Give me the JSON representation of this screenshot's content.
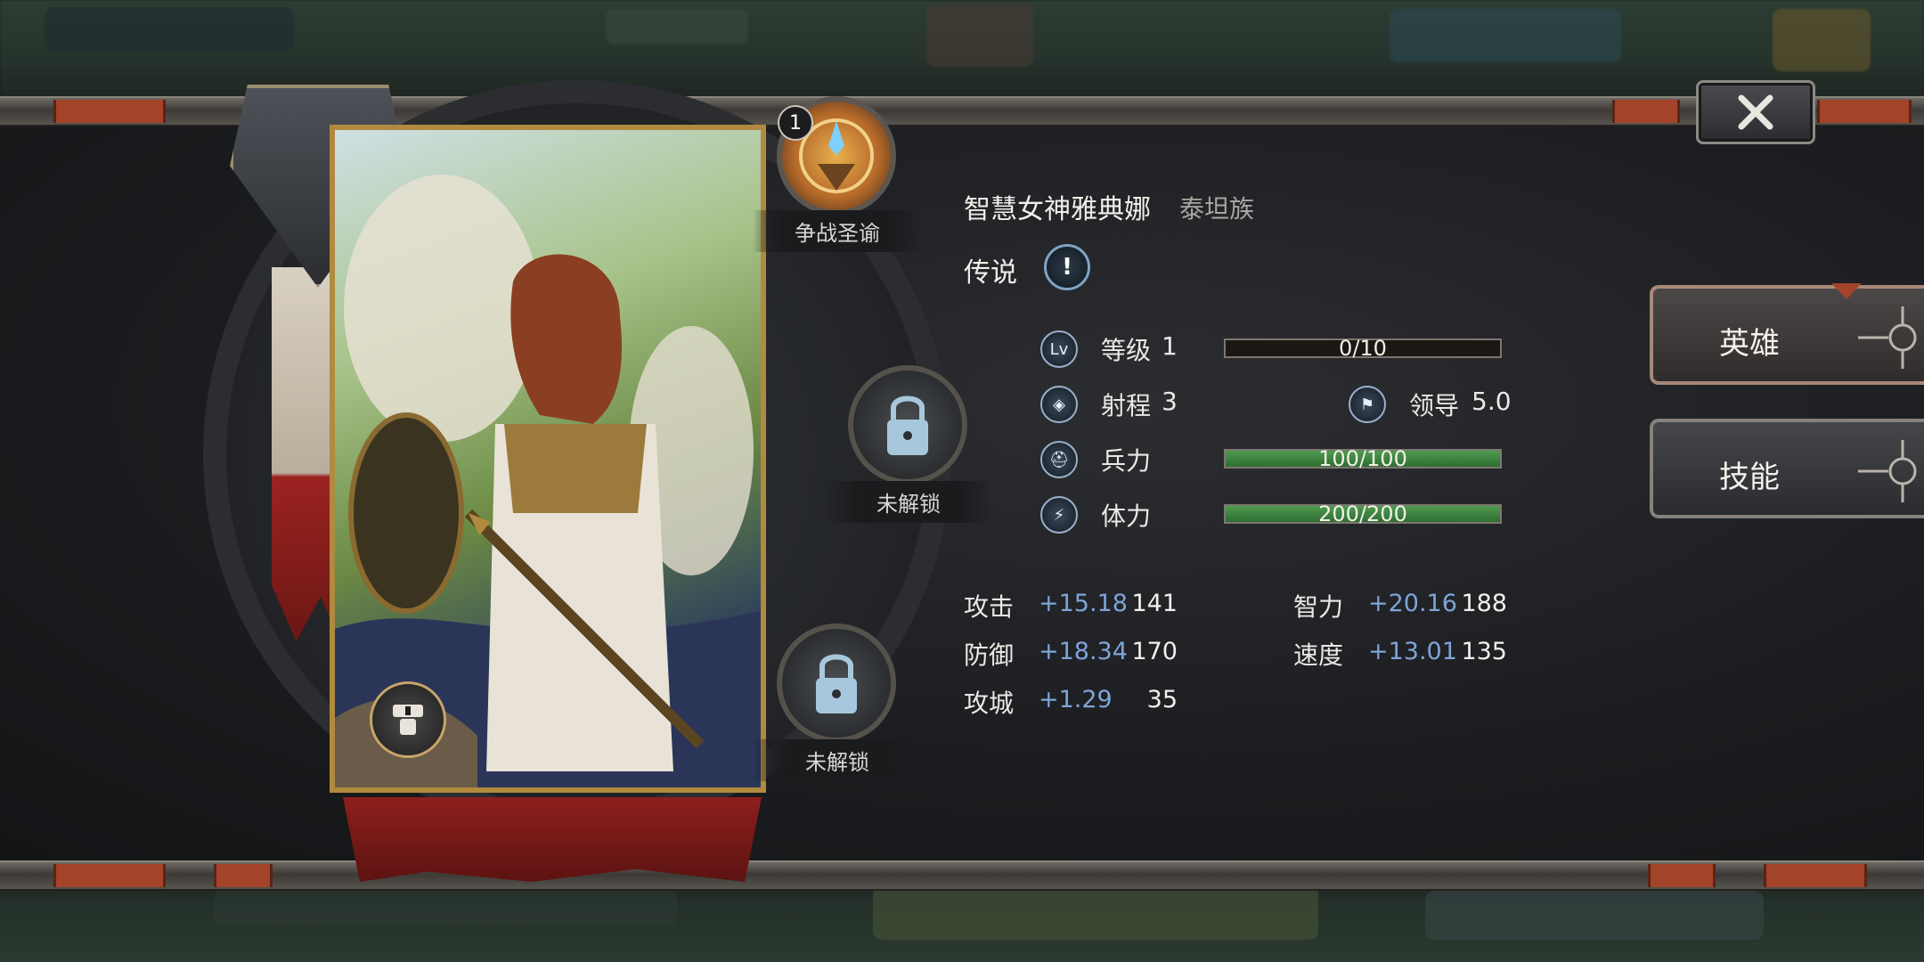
{
  "hero": {
    "name": "智慧女神雅典娜",
    "race": "泰坦族",
    "rarity": "传说",
    "rarity_icon_glyph": "!"
  },
  "skills": {
    "slot1": {
      "badge": "1",
      "label": "争战圣谕"
    },
    "slot2": {
      "label": "未解锁"
    },
    "slot3": {
      "label": "未解锁"
    }
  },
  "stats": {
    "level": {
      "label": "等级",
      "value": "1",
      "bar_text": "0/10",
      "progress": 0.0
    },
    "range": {
      "label": "射程",
      "value": "3"
    },
    "leadership": {
      "label": "领导",
      "value": "5.0"
    },
    "troops": {
      "label": "兵力",
      "bar_text": "100/100",
      "progress": 1.0
    },
    "stamina": {
      "label": "体力",
      "bar_text": "200/200",
      "progress": 1.0
    }
  },
  "attributes": [
    {
      "label": "攻击",
      "bonus": "+15.18",
      "value": "141"
    },
    {
      "label": "防御",
      "bonus": "+18.34",
      "value": "170"
    },
    {
      "label": "攻城",
      "bonus": "+1.29",
      "value": "35"
    },
    {
      "label": "智力",
      "bonus": "+20.16",
      "value": "188"
    },
    {
      "label": "速度",
      "bonus": "+13.01",
      "value": "135"
    }
  ],
  "tabs": {
    "hero": "英雄",
    "skills": "技能"
  },
  "icons": {
    "level": "Lv",
    "range": "◈",
    "leadership": "⚑",
    "troops": "⛑",
    "stamina": "⚡"
  },
  "colors": {
    "bonus": "#7ea4d8",
    "bar_fill": "#3f8a42",
    "accent_red": "#a2432a",
    "frame_gold": "#b08a3e"
  }
}
